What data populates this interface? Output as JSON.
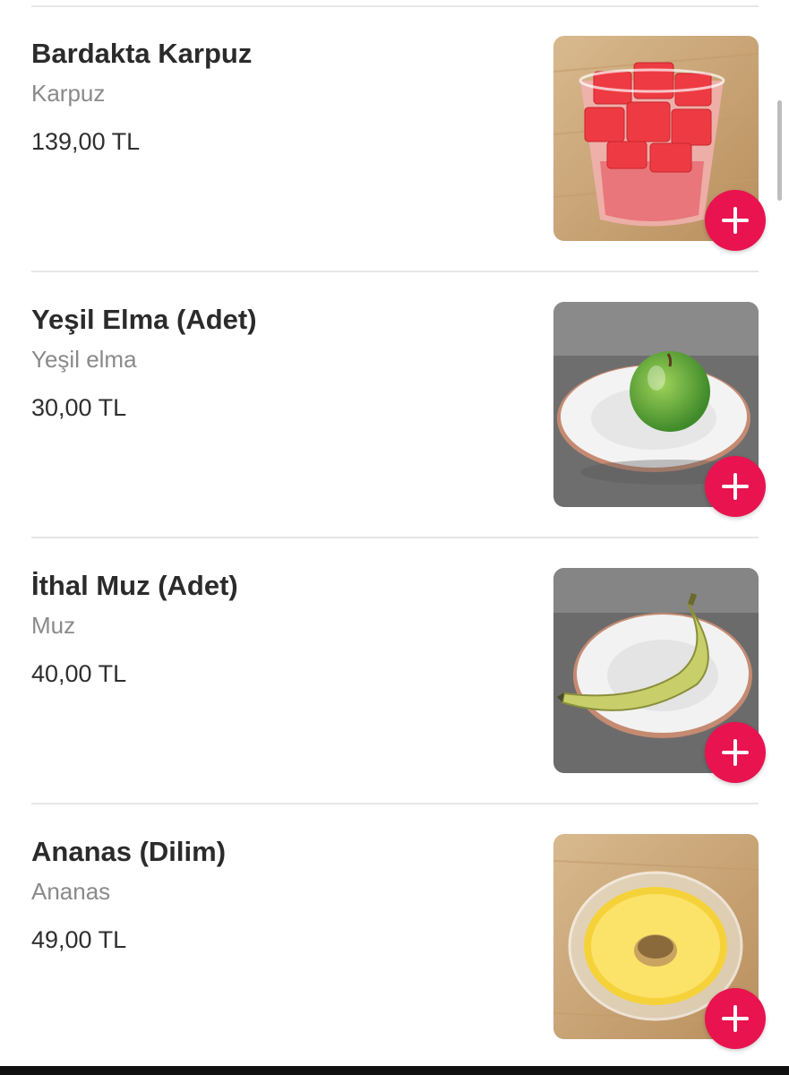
{
  "products": [
    {
      "name": "Bardakta Karpuz",
      "description": "Karpuz",
      "price": "139,00 TL",
      "image_icon": "watermelon-cup-image",
      "add_icon": "plus-icon"
    },
    {
      "name": "Yeşil Elma (Adet)",
      "description": "Yeşil elma",
      "price": "30,00 TL",
      "image_icon": "green-apple-image",
      "add_icon": "plus-icon"
    },
    {
      "name": "İthal Muz (Adet)",
      "description": "Muz",
      "price": "40,00 TL",
      "image_icon": "banana-image",
      "add_icon": "plus-icon"
    },
    {
      "name": "Ananas (Dilim)",
      "description": "Ananas",
      "price": "49,00 TL",
      "image_icon": "pineapple-slice-image",
      "add_icon": "plus-icon"
    }
  ],
  "colors": {
    "accent": "#e8134f",
    "title": "#2b2b2b",
    "subtitle": "#8a8a8a",
    "divider": "#e6e6e6"
  }
}
